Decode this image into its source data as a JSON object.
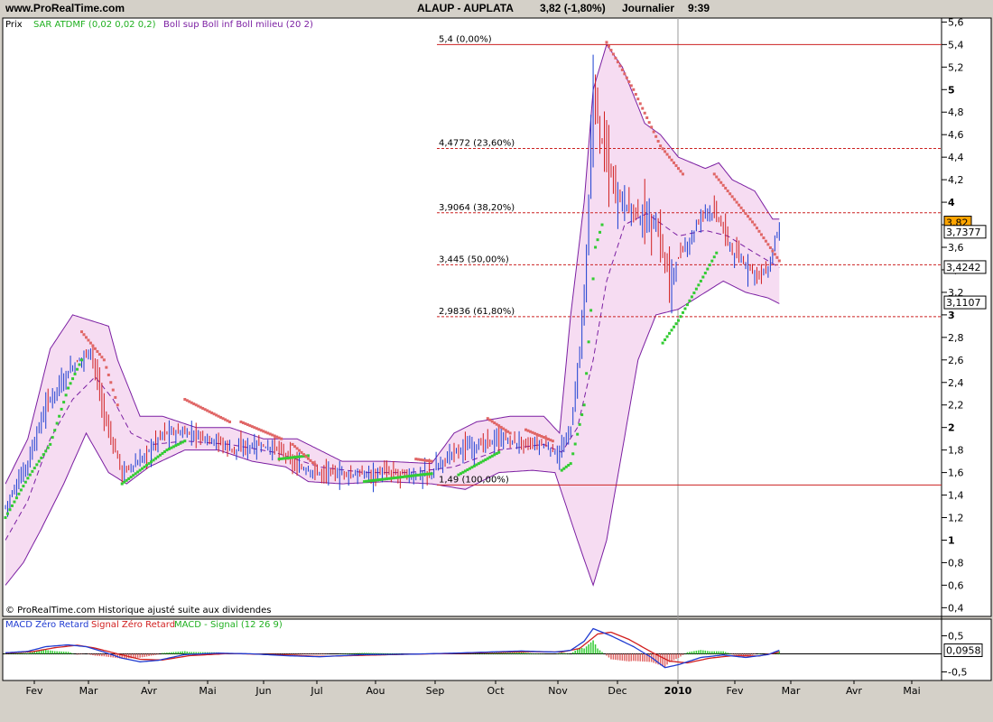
{
  "header": {
    "site": "www.ProRealTime.com",
    "symbol": "ALAUP - AUPLATA",
    "last": "3,82 (-1,80%)",
    "period": "Journalier",
    "time": "9:39"
  },
  "legend_price": {
    "prix": "Prix",
    "sar": "SAR ATDMF (0,02 0,02 0,2)",
    "boll": "Boll sup Boll inf Boll milieu (20 2)"
  },
  "legend_macd": {
    "macd": "MACD Zéro Retard",
    "signal": "Signal Zéro Retard",
    "hist": "MACD - Signal (12 26 9)"
  },
  "copyright": "© ProRealTime.com Historique ajusté suite aux dividendes",
  "colors": {
    "up": "#1a3fd1",
    "down": "#d12020",
    "sar_up": "#33cc33",
    "sar_down": "#e06666",
    "boll_line": "#7b1fa2",
    "boll_fill": "#f6dcf2",
    "fib": "#cc2222",
    "macd": "#1f3bd1",
    "signal": "#d11f1f"
  },
  "chart_data": [
    {
      "type": "candlestick",
      "title": "ALAUP - AUPLATA",
      "price_axis": {
        "ticks": [
          "5,6",
          "5,4",
          "5,2",
          "5",
          "4,8",
          "4,6",
          "4,4",
          "4,2",
          "4",
          "3,8",
          "3,6",
          "3,4",
          "3,2",
          "3",
          "2,8",
          "2,6",
          "2,4",
          "2,2",
          "2",
          "1,8",
          "1,6",
          "1,4",
          "1,2",
          "1",
          "0,8",
          "0,6",
          "0,4"
        ],
        "ylim": [
          0.4,
          5.6
        ]
      },
      "time_axis": {
        "ticks": [
          "Fev",
          "Mar",
          "Avr",
          "Mai",
          "Jun",
          "Jul",
          "Aou",
          "Sep",
          "Oct",
          "Nov",
          "Dec",
          "2010",
          "Fev",
          "Mar",
          "Avr",
          "Mai"
        ]
      },
      "price_badges": [
        {
          "value": 3.82,
          "label": "3,82"
        },
        {
          "value": 3.7377,
          "label": "3,7377"
        },
        {
          "value": 3.4242,
          "label": "3,4242"
        },
        {
          "value": 3.1107,
          "label": "3,1107"
        }
      ],
      "fibonacci": [
        {
          "value": 5.4,
          "label": "5,4 (0,00%)"
        },
        {
          "value": 4.4772,
          "label": "4,4772 (23,60%)"
        },
        {
          "value": 3.9064,
          "label": "3,9064 (38,20%)"
        },
        {
          "value": 3.445,
          "label": "3,445 (50,00%)"
        },
        {
          "value": 2.9836,
          "label": "2,9836 (61,80%)"
        },
        {
          "value": 1.49,
          "label": "1,49 (100,00%)"
        }
      ],
      "close_anchors": [
        [
          0,
          1.3
        ],
        [
          10,
          1.7
        ],
        [
          18,
          2.2
        ],
        [
          28,
          2.5
        ],
        [
          38,
          2.7
        ],
        [
          44,
          2.1
        ],
        [
          52,
          1.6
        ],
        [
          60,
          1.7
        ],
        [
          70,
          1.95
        ],
        [
          82,
          1.95
        ],
        [
          92,
          1.9
        ],
        [
          102,
          1.8
        ],
        [
          112,
          1.85
        ],
        [
          122,
          1.8
        ],
        [
          130,
          1.65
        ],
        [
          140,
          1.6
        ],
        [
          155,
          1.58
        ],
        [
          170,
          1.6
        ],
        [
          182,
          1.57
        ],
        [
          190,
          1.6
        ],
        [
          200,
          1.8
        ],
        [
          212,
          1.85
        ],
        [
          222,
          1.9
        ],
        [
          230,
          1.85
        ],
        [
          240,
          1.85
        ],
        [
          247,
          1.75
        ],
        [
          252,
          2.0
        ],
        [
          256,
          2.7
        ],
        [
          259,
          3.5
        ],
        [
          262,
          5.1
        ],
        [
          264,
          4.7
        ],
        [
          268,
          4.4
        ],
        [
          272,
          4.1
        ],
        [
          278,
          3.95
        ],
        [
          284,
          3.85
        ],
        [
          290,
          3.8
        ],
        [
          296,
          3.3
        ],
        [
          300,
          3.5
        ],
        [
          306,
          3.7
        ],
        [
          312,
          3.95
        ],
        [
          318,
          3.85
        ],
        [
          324,
          3.55
        ],
        [
          330,
          3.45
        ],
        [
          336,
          3.35
        ],
        [
          340,
          3.4
        ],
        [
          345,
          3.82
        ]
      ],
      "bollinger_upper_anchors": [
        [
          0,
          1.5
        ],
        [
          10,
          1.9
        ],
        [
          20,
          2.7
        ],
        [
          30,
          3.0
        ],
        [
          38,
          2.95
        ],
        [
          46,
          2.9
        ],
        [
          50,
          2.6
        ],
        [
          60,
          2.1
        ],
        [
          70,
          2.1
        ],
        [
          85,
          2.0
        ],
        [
          100,
          2.0
        ],
        [
          115,
          1.9
        ],
        [
          130,
          1.9
        ],
        [
          150,
          1.7
        ],
        [
          170,
          1.7
        ],
        [
          190,
          1.68
        ],
        [
          200,
          1.95
        ],
        [
          210,
          2.05
        ],
        [
          225,
          2.1
        ],
        [
          240,
          2.1
        ],
        [
          247,
          1.95
        ],
        [
          252,
          3.0
        ],
        [
          258,
          4.0
        ],
        [
          262,
          5.0
        ],
        [
          268,
          5.4
        ],
        [
          275,
          5.2
        ],
        [
          285,
          4.7
        ],
        [
          292,
          4.6
        ],
        [
          300,
          4.4
        ],
        [
          312,
          4.3
        ],
        [
          318,
          4.35
        ],
        [
          324,
          4.2
        ],
        [
          334,
          4.1
        ],
        [
          342,
          3.85
        ],
        [
          345,
          3.85
        ]
      ],
      "bollinger_lower_anchors": [
        [
          0,
          0.6
        ],
        [
          8,
          0.8
        ],
        [
          16,
          1.1
        ],
        [
          26,
          1.5
        ],
        [
          36,
          1.95
        ],
        [
          46,
          1.6
        ],
        [
          54,
          1.5
        ],
        [
          64,
          1.65
        ],
        [
          80,
          1.8
        ],
        [
          95,
          1.8
        ],
        [
          110,
          1.7
        ],
        [
          125,
          1.65
        ],
        [
          135,
          1.52
        ],
        [
          150,
          1.5
        ],
        [
          170,
          1.52
        ],
        [
          190,
          1.5
        ],
        [
          205,
          1.45
        ],
        [
          220,
          1.6
        ],
        [
          235,
          1.62
        ],
        [
          245,
          1.6
        ],
        [
          255,
          1.0
        ],
        [
          262,
          0.6
        ],
        [
          268,
          1.0
        ],
        [
          275,
          1.8
        ],
        [
          282,
          2.6
        ],
        [
          290,
          3.0
        ],
        [
          300,
          3.05
        ],
        [
          312,
          3.2
        ],
        [
          320,
          3.3
        ],
        [
          330,
          3.2
        ],
        [
          340,
          3.15
        ],
        [
          345,
          3.1
        ]
      ],
      "bollinger_mid_anchors": [
        [
          0,
          1.0
        ],
        [
          10,
          1.35
        ],
        [
          20,
          1.9
        ],
        [
          30,
          2.25
        ],
        [
          40,
          2.45
        ],
        [
          48,
          2.25
        ],
        [
          56,
          1.95
        ],
        [
          66,
          1.85
        ],
        [
          80,
          1.88
        ],
        [
          100,
          1.85
        ],
        [
          120,
          1.78
        ],
        [
          140,
          1.65
        ],
        [
          160,
          1.6
        ],
        [
          180,
          1.6
        ],
        [
          200,
          1.65
        ],
        [
          220,
          1.8
        ],
        [
          240,
          1.85
        ],
        [
          248,
          1.78
        ],
        [
          255,
          2.0
        ],
        [
          262,
          2.6
        ],
        [
          268,
          3.3
        ],
        [
          276,
          3.8
        ],
        [
          286,
          3.9
        ],
        [
          300,
          3.7
        ],
        [
          312,
          3.75
        ],
        [
          322,
          3.7
        ],
        [
          334,
          3.55
        ],
        [
          345,
          3.42
        ]
      ],
      "sar_up_segments": [
        [
          [
            0,
            1.2
          ],
          [
            10,
            1.55
          ],
          [
            20,
            1.85
          ],
          [
            28,
            2.35
          ],
          [
            34,
            2.6
          ]
        ],
        [
          [
            52,
            1.5
          ],
          [
            60,
            1.62
          ],
          [
            72,
            1.8
          ],
          [
            80,
            1.88
          ]
        ],
        [
          [
            122,
            1.72
          ],
          [
            135,
            1.75
          ]
        ],
        [
          [
            160,
            1.52
          ],
          [
            185,
            1.58
          ],
          [
            190,
            1.59
          ]
        ],
        [
          [
            202,
            1.58
          ],
          [
            220,
            1.78
          ]
        ],
        [
          [
            248,
            1.62
          ],
          [
            252,
            1.68
          ],
          [
            258,
            2.2
          ],
          [
            263,
            3.6
          ],
          [
            266,
            3.8
          ]
        ],
        [
          [
            293,
            2.75
          ],
          [
            300,
            2.95
          ],
          [
            310,
            3.3
          ],
          [
            317,
            3.55
          ]
        ]
      ],
      "sar_down_segments": [
        [
          [
            34,
            2.85
          ],
          [
            44,
            2.6
          ],
          [
            50,
            2.2
          ]
        ],
        [
          [
            80,
            2.25
          ],
          [
            100,
            2.05
          ]
        ],
        [
          [
            105,
            2.05
          ],
          [
            123,
            1.9
          ]
        ],
        [
          [
            128,
            1.85
          ],
          [
            138,
            1.67
          ]
        ],
        [
          [
            183,
            1.72
          ],
          [
            190,
            1.7
          ]
        ],
        [
          [
            215,
            2.08
          ],
          [
            225,
            1.95
          ]
        ],
        [
          [
            232,
            1.98
          ],
          [
            244,
            1.88
          ]
        ],
        [
          [
            268,
            5.42
          ],
          [
            280,
            5.0
          ],
          [
            292,
            4.5
          ],
          [
            302,
            4.25
          ]
        ],
        [
          [
            316,
            4.25
          ],
          [
            334,
            3.8
          ],
          [
            345,
            3.48
          ]
        ]
      ],
      "volume_note": ""
    },
    {
      "type": "macd",
      "title": "MACD Zéro Retard",
      "ylim": [
        -0.62,
        0.9
      ],
      "y_ticks": [
        "0,5",
        "-0,5"
      ],
      "value_badge": "0,0958",
      "macd_anchors": [
        [
          0,
          0.03
        ],
        [
          10,
          0.07
        ],
        [
          18,
          0.2
        ],
        [
          28,
          0.25
        ],
        [
          36,
          0.2
        ],
        [
          44,
          0.05
        ],
        [
          52,
          -0.12
        ],
        [
          60,
          -0.22
        ],
        [
          68,
          -0.18
        ],
        [
          80,
          -0.02
        ],
        [
          95,
          0.02
        ],
        [
          110,
          0.0
        ],
        [
          125,
          -0.05
        ],
        [
          140,
          -0.08
        ],
        [
          160,
          -0.02
        ],
        [
          180,
          -0.01
        ],
        [
          200,
          0.02
        ],
        [
          215,
          0.05
        ],
        [
          230,
          0.08
        ],
        [
          245,
          0.05
        ],
        [
          252,
          0.1
        ],
        [
          258,
          0.35
        ],
        [
          262,
          0.7
        ],
        [
          266,
          0.6
        ],
        [
          270,
          0.5
        ],
        [
          280,
          0.2
        ],
        [
          288,
          -0.1
        ],
        [
          294,
          -0.38
        ],
        [
          300,
          -0.3
        ],
        [
          310,
          -0.1
        ],
        [
          320,
          -0.03
        ],
        [
          330,
          -0.1
        ],
        [
          340,
          -0.02
        ],
        [
          345,
          0.1
        ]
      ],
      "signal_anchors": [
        [
          0,
          0.02
        ],
        [
          12,
          0.06
        ],
        [
          22,
          0.17
        ],
        [
          32,
          0.24
        ],
        [
          40,
          0.16
        ],
        [
          50,
          0.0
        ],
        [
          60,
          -0.15
        ],
        [
          70,
          -0.17
        ],
        [
          82,
          -0.05
        ],
        [
          100,
          0.01
        ],
        [
          120,
          -0.02
        ],
        [
          140,
          -0.07
        ],
        [
          160,
          -0.04
        ],
        [
          180,
          -0.01
        ],
        [
          200,
          0.01
        ],
        [
          218,
          0.04
        ],
        [
          235,
          0.06
        ],
        [
          248,
          0.05
        ],
        [
          256,
          0.15
        ],
        [
          264,
          0.55
        ],
        [
          270,
          0.6
        ],
        [
          278,
          0.4
        ],
        [
          288,
          0.05
        ],
        [
          296,
          -0.2
        ],
        [
          304,
          -0.25
        ],
        [
          314,
          -0.12
        ],
        [
          324,
          -0.05
        ],
        [
          336,
          -0.06
        ],
        [
          345,
          0.05
        ]
      ]
    }
  ]
}
